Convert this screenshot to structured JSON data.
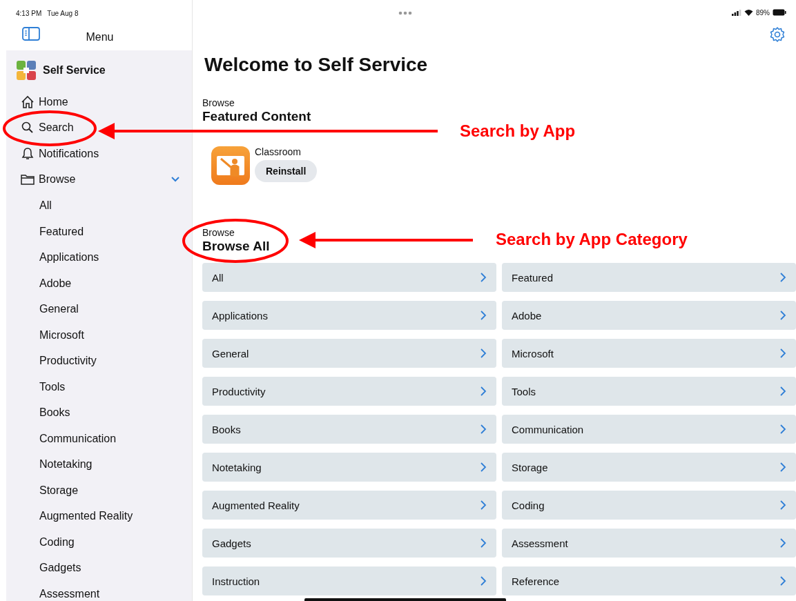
{
  "status_bar": {
    "time": "4:13 PM",
    "date": "Tue Aug 8",
    "battery": "89%"
  },
  "sidebar": {
    "title": "Menu",
    "brand": "Self Service",
    "items": [
      {
        "label": "Home",
        "kind": "home",
        "selected": false
      },
      {
        "label": "Search",
        "kind": "search",
        "selected": false
      },
      {
        "label": "Notifications",
        "kind": "bell",
        "selected": false
      },
      {
        "label": "Browse",
        "kind": "folder",
        "selected": false,
        "expanded": true,
        "children": [
          {
            "label": "All"
          },
          {
            "label": "Featured"
          },
          {
            "label": "Applications"
          },
          {
            "label": "Adobe"
          },
          {
            "label": "General"
          },
          {
            "label": "Microsoft"
          },
          {
            "label": "Productivity"
          },
          {
            "label": "Tools"
          },
          {
            "label": "Books"
          },
          {
            "label": "Communication"
          },
          {
            "label": "Notetaking"
          },
          {
            "label": "Storage"
          },
          {
            "label": "Augmented Reality"
          },
          {
            "label": "Coding"
          },
          {
            "label": "Gadgets"
          },
          {
            "label": "Assessment"
          }
        ]
      }
    ]
  },
  "main": {
    "title": "Welcome to Self Service",
    "featured": {
      "eyebrow": "Browse",
      "heading": "Featured Content",
      "apps": [
        {
          "name": "Classroom",
          "button": "Reinstall"
        }
      ]
    },
    "browse_all": {
      "eyebrow": "Browse",
      "heading": "Browse All",
      "categories": [
        "All",
        "Featured",
        "Applications",
        "Adobe",
        "General",
        "Microsoft",
        "Productivity",
        "Tools",
        "Books",
        "Communication",
        "Notetaking",
        "Storage",
        "Augmented Reality",
        "Coding",
        "Gadgets",
        "Assessment",
        "Instruction",
        "Reference"
      ]
    }
  },
  "annotations": [
    {
      "text": "Search by App"
    },
    {
      "text": "Search by App Category"
    }
  ]
}
